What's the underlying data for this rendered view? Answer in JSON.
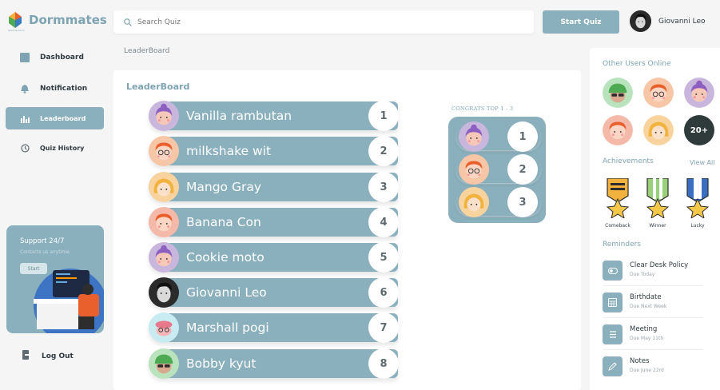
{
  "app": {
    "name": "Dormmates",
    "tagline": "Quizme Dorm"
  },
  "search": {
    "placeholder": "Search Quiz"
  },
  "header": {
    "start_quiz": "Start Quiz",
    "user_name": "Giovanni Leo"
  },
  "sidebar": {
    "items": [
      {
        "label": "Dashboard",
        "icon": "dashboard-icon"
      },
      {
        "label": "Notification",
        "icon": "bell-icon"
      },
      {
        "label": "Leaderboard",
        "icon": "bar-chart-icon",
        "active": true
      },
      {
        "label": "Quiz History",
        "icon": "history-icon"
      }
    ],
    "support": {
      "title": "Support 24/7",
      "subtitle": "Contacts us anytime",
      "button": "Start"
    },
    "logout": "Log Out"
  },
  "breadcrumb": "LeaderBoard",
  "leaderboard": {
    "title": "LeaderBoard",
    "rows": [
      {
        "name": "Vanilla rambutan",
        "rank": "1",
        "avatar": "purple-hair"
      },
      {
        "name": "milkshake wit",
        "rank": "2",
        "avatar": "orange-hair-glasses"
      },
      {
        "name": "Mango Gray",
        "rank": "3",
        "avatar": "blonde-hair"
      },
      {
        "name": "Banana Con",
        "rank": "4",
        "avatar": "orange-hair"
      },
      {
        "name": "Cookie moto",
        "rank": "5",
        "avatar": "purple-hair"
      },
      {
        "name": "Giovanni Leo",
        "rank": "6",
        "avatar": "photo"
      },
      {
        "name": "Marshall pogi",
        "rank": "7",
        "avatar": "pink-hat"
      },
      {
        "name": "Bobby kyut",
        "rank": "8",
        "avatar": "green-cap"
      }
    ]
  },
  "congrats": {
    "title": "CONGRATS TOP 1 - 3",
    "ranks": [
      "1",
      "2",
      "3"
    ]
  },
  "right_panel": {
    "online_title": "Other Users Online",
    "online_more": "20+",
    "achievements_title": "Achievements",
    "view_all": "View All",
    "achievements": [
      "Comeback",
      "Winner",
      "Lucky"
    ],
    "reminders_title": "Reminders",
    "reminders": [
      {
        "title": "Clear Desk Policy",
        "sub": "Due Today",
        "icon": "toggle-icon"
      },
      {
        "title": "Birthdate",
        "sub": "Due Next Week",
        "icon": "calendar-icon"
      },
      {
        "title": "Meeting",
        "sub": "Due May 11th",
        "icon": "list-icon"
      },
      {
        "title": "Notes",
        "sub": "Due June 22rd",
        "icon": "pen-icon"
      }
    ]
  },
  "colors": {
    "accent": "#8ab0bd",
    "accent_text": "#7ea3b1"
  }
}
